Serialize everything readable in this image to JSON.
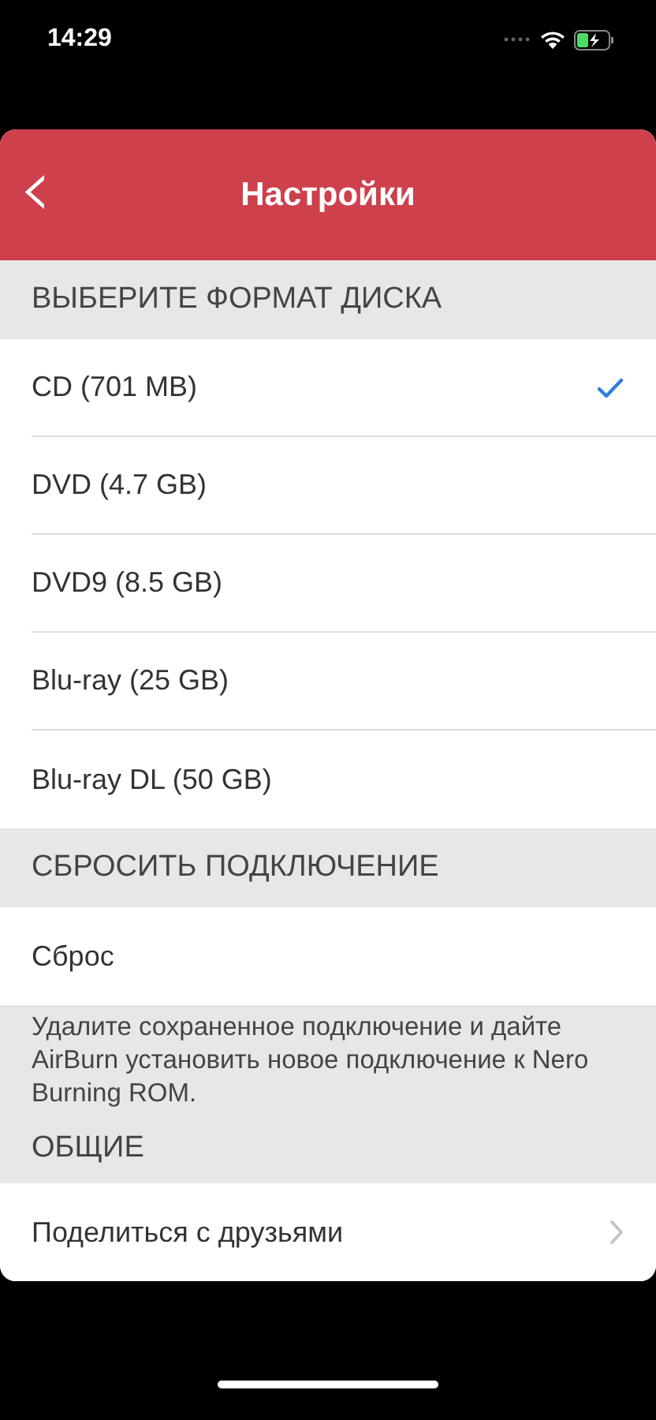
{
  "status_bar": {
    "time": "14:29"
  },
  "nav_bar": {
    "title": "Настройки",
    "back": "‹"
  },
  "sections": [
    {
      "header": "ВЫБЕРИТЕ ФОРМАТ ДИСКА",
      "items": [
        {
          "label": "CD (701 MB)",
          "kind": "option",
          "selected": true
        },
        {
          "label": "DVD (4.7 GB)",
          "kind": "option",
          "selected": false
        },
        {
          "label": "DVD9 (8.5 GB)",
          "kind": "option",
          "selected": false
        },
        {
          "label": "Blu-ray (25 GB)",
          "kind": "option",
          "selected": false
        },
        {
          "label": "Blu-ray DL (50 GB)",
          "kind": "option",
          "selected": false
        }
      ]
    },
    {
      "header": "СБРОСИТЬ ПОДКЛЮЧЕНИЕ",
      "items": [
        {
          "label": "Сброс",
          "kind": "action"
        }
      ],
      "footer": "Удалите сохраненное подключение и дайте AirBurn установить новое подключение к Nero Burning ROM."
    },
    {
      "header": "ОБЩИЕ",
      "items": [
        {
          "label": "Поделиться с друзьями",
          "kind": "link"
        }
      ]
    }
  ]
}
